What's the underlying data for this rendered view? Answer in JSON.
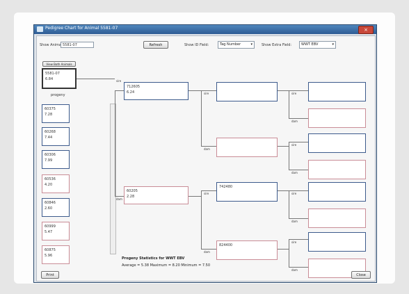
{
  "window": {
    "title": "Pedigree Chart for Animal 5581-07"
  },
  "toolbar": {
    "show_animal_label": "Show Animal:",
    "show_animal_value": "5581-07",
    "refresh_label": "Refresh",
    "show_id_field_label": "Show ID Field:",
    "show_id_field_value": "Tag Number",
    "show_extra_field_label": "Show Extra Field:",
    "show_extra_field_value": "WWT EBV"
  },
  "progeny_panel": {
    "view_button_label": "View Both Animals",
    "selected_id": "5581-07",
    "selected_value": "6.84",
    "progeny_label": "progeny",
    "items": [
      {
        "id": "60375",
        "value": "7.28"
      },
      {
        "id": "60268",
        "value": "7.44"
      },
      {
        "id": "60306",
        "value": "7.99"
      },
      {
        "id": "60536",
        "value": "4.20"
      },
      {
        "id": "60846",
        "value": "2.60"
      },
      {
        "id": "60999",
        "value": "5.47"
      },
      {
        "id": "60875",
        "value": "5.96"
      }
    ]
  },
  "pedigree": {
    "sire": {
      "id": "712605",
      "value": "6.24"
    },
    "dam": {
      "id": "60205",
      "value": "2.28"
    },
    "dam_sire": {
      "id": "742480"
    },
    "dam_dam": {
      "id": "824400"
    },
    "tags": {
      "sire": "sire",
      "dam": "dam"
    }
  },
  "statistics": {
    "title": "Progeny Statistics for WWT EBV",
    "line": "Average = 5.38  Maximum = 8.20  Minimum = 7.50"
  },
  "footer": {
    "print_label": "Print",
    "close_label": "Close"
  }
}
